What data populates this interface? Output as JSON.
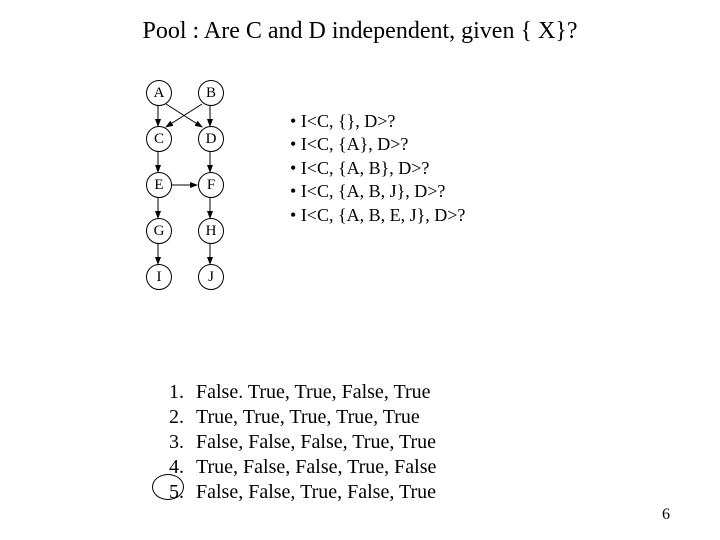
{
  "title": "Pool :  Are  C and D independent, given { X}?",
  "graph": {
    "nodes": {
      "A": "A",
      "B": "B",
      "C": "C",
      "D": "D",
      "E": "E",
      "F": "F",
      "G": "G",
      "H": "H",
      "I": "I",
      "J": "J"
    },
    "edges": [
      [
        "A",
        "C"
      ],
      [
        "A",
        "D"
      ],
      [
        "B",
        "C"
      ],
      [
        "B",
        "D"
      ],
      [
        "C",
        "E"
      ],
      [
        "D",
        "F"
      ],
      [
        "E",
        "F"
      ],
      [
        "E",
        "G"
      ],
      [
        "F",
        "H"
      ],
      [
        "G",
        "I"
      ],
      [
        "H",
        "J"
      ]
    ]
  },
  "queries": [
    "I<C, {}, D>?",
    "I<C, {A}, D>?",
    "I<C, {A, B}, D>?",
    "I<C, {A, B, J}, D>?",
    "I<C, {A, B, E, J}, D>?"
  ],
  "answers": [
    {
      "n": "1.",
      "t": "False. True, True, False, True"
    },
    {
      "n": "2.",
      "t": "True,  True, True, True, True"
    },
    {
      "n": "3.",
      "t": "False, False, False, True, True"
    },
    {
      "n": "4.",
      "t": "True, False, False, True, False"
    },
    {
      "n": "5.",
      "t": "False, False, True, False, True"
    }
  ],
  "circled_answer_index": 4,
  "page_number": "6"
}
